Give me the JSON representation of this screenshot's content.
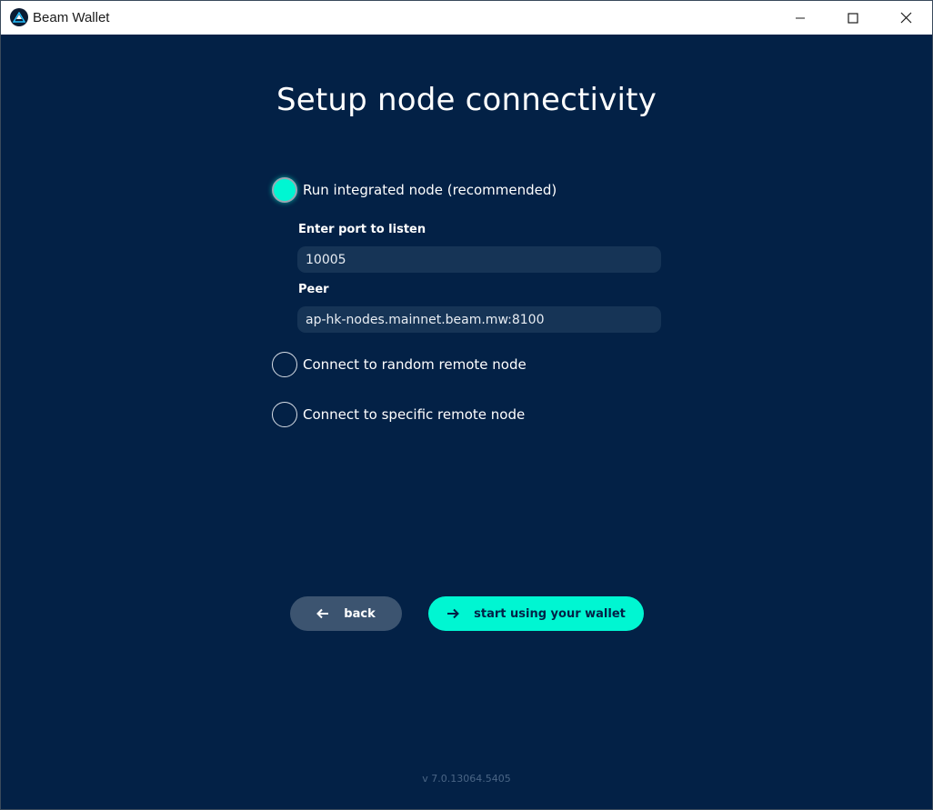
{
  "window": {
    "title": "Beam Wallet"
  },
  "page": {
    "heading": "Setup node connectivity"
  },
  "options": {
    "integrated": {
      "label": "Run integrated node (recommended)",
      "selected": true
    },
    "random_remote": {
      "label": "Connect to random remote node",
      "selected": false
    },
    "specific_remote": {
      "label": "Connect to specific remote node",
      "selected": false
    }
  },
  "fields": {
    "port": {
      "label": "Enter port to listen",
      "value": "10005"
    },
    "peer": {
      "label": "Peer",
      "value": "ap-hk-nodes.mainnet.beam.mw:8100"
    }
  },
  "buttons": {
    "back": "back",
    "start": "start using your wallet"
  },
  "footer": {
    "version": "v 7.0.13064.5405"
  },
  "colors": {
    "background": "#032146",
    "accent": "#00f6d2",
    "input_bg": "#163456",
    "back_button": "#3c5470"
  },
  "icons": {
    "app": "beam-logo-icon",
    "minimize": "minimize-icon",
    "maximize": "maximize-icon",
    "close": "close-icon",
    "back": "arrow-left-icon",
    "start": "arrow-right-icon"
  }
}
